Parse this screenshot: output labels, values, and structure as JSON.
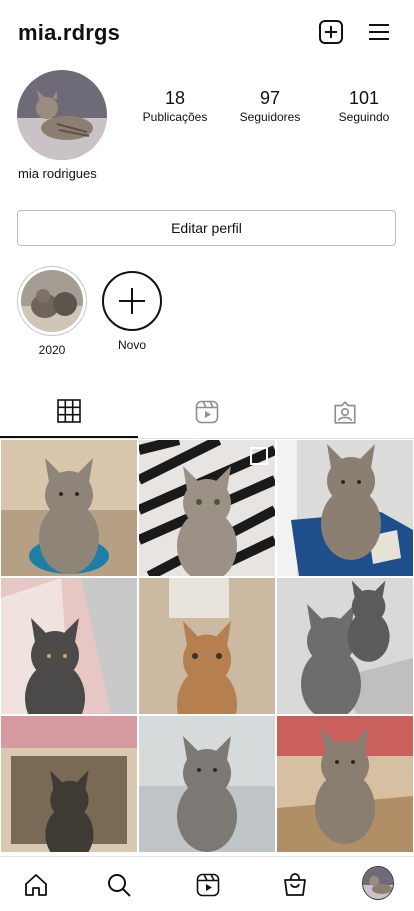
{
  "header": {
    "username": "mia.rdrgs",
    "icons": [
      "new-post-icon",
      "menu-icon"
    ]
  },
  "profile": {
    "stats": [
      {
        "value": "18",
        "label": "Publicações"
      },
      {
        "value": "97",
        "label": "Seguidores"
      },
      {
        "value": "101",
        "label": "Seguindo"
      }
    ],
    "full_name": "mia rodrigues",
    "edit_button": "Editar perfil"
  },
  "highlights": [
    {
      "label": "2020"
    },
    {
      "label": "Novo"
    }
  ],
  "tabs": [
    "grid-icon",
    "reels-icon",
    "tagged-icon"
  ],
  "grid": {
    "posts": 9,
    "multi_image_post": 2
  },
  "bottom_nav": [
    "home-icon",
    "search-icon",
    "reels-icon",
    "shop-icon",
    "profile-avatar"
  ],
  "colors": {
    "text": "#111111",
    "border": "#bdbdbd",
    "background": "#ffffff"
  }
}
